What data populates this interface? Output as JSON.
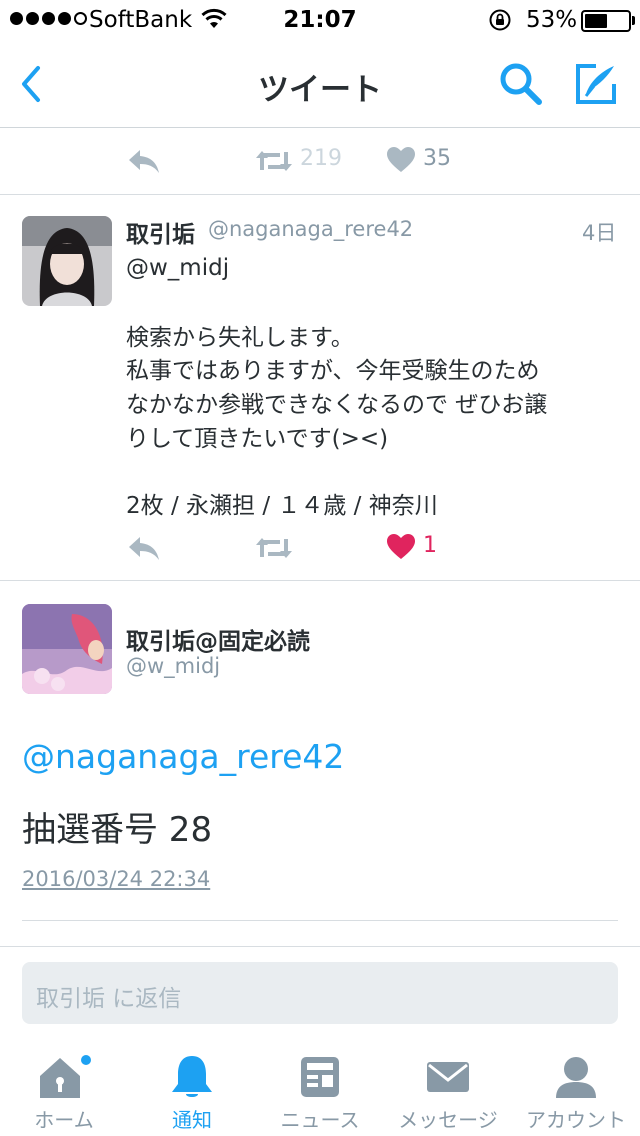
{
  "status_bar": {
    "carrier": "SoftBank",
    "time": "21:07",
    "battery_percent": "53%",
    "battery_level": 0.53
  },
  "nav": {
    "title": "ツイート",
    "icons": [
      "chevron-left-icon",
      "search-icon",
      "compose-icon"
    ],
    "accent_color": "#1da1f2"
  },
  "prev_tweet_actions": {
    "retweet_count": "219",
    "like_count": "35"
  },
  "reply_tweet": {
    "name": "取引垢",
    "handle": "@naganaga_rere42",
    "date": "4日",
    "mention": "@w_midj",
    "body_lines": [
      "検索から失礼します。",
      "私事ではありますが、今年受験生のため",
      "なかなか参戦できなくなるので ぜひお譲",
      "りして頂きたいです(><)",
      "",
      "2枚 / 永瀬担 / １４歳 / 神奈川"
    ],
    "like_count": "1",
    "like_color": "#e0245e"
  },
  "main_tweet": {
    "name": "取引垢@固定必読",
    "handle": "@w_midj",
    "mention": "@naganaga_rere42",
    "text": "抽選番号 28",
    "timestamp": "2016/03/24 22:34"
  },
  "reply_box": {
    "placeholder": "取引垢 に返信"
  },
  "tab_bar": {
    "tabs": [
      {
        "label": "ホーム",
        "icon": "home-icon"
      },
      {
        "label": "通知",
        "icon": "bell-icon"
      },
      {
        "label": "ニュース",
        "icon": "news-icon"
      },
      {
        "label": "メッセージ",
        "icon": "envelope-icon"
      },
      {
        "label": "アカウント",
        "icon": "person-icon"
      }
    ],
    "active_index": 1
  }
}
